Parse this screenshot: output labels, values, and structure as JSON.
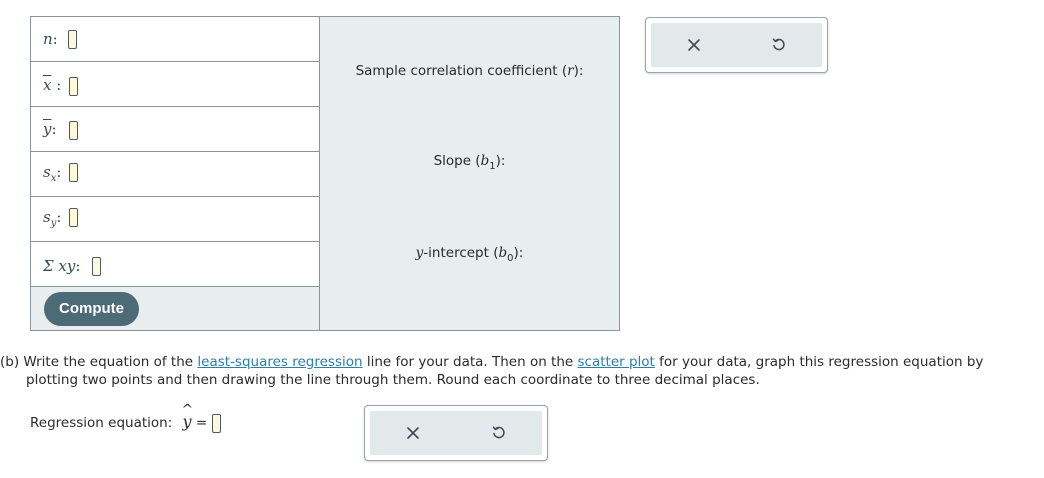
{
  "calculator": {
    "inputs": [
      {
        "id": "n",
        "label": "n",
        "value": ""
      },
      {
        "id": "xbar",
        "label": "x",
        "value": ""
      },
      {
        "id": "ybar",
        "label": "y",
        "value": ""
      },
      {
        "id": "sx",
        "label": "s",
        "sub": "x",
        "value": ""
      },
      {
        "id": "sy",
        "label": "s",
        "sub": "y",
        "value": ""
      },
      {
        "id": "sumxy",
        "label": "Σ xy",
        "value": ""
      }
    ],
    "compute_label": "Compute",
    "outputs": {
      "r_label_prefix": "Sample correlation coefficient (",
      "r_label_var": "r",
      "r_label_suffix": "):",
      "slope_prefix": "Slope (",
      "slope_var": "b",
      "slope_sub": "1",
      "slope_suffix": "):",
      "intercept_var": "y",
      "intercept_mid": "-intercept (",
      "intercept_var2": "b",
      "intercept_sub": "0",
      "intercept_suffix": "):"
    }
  },
  "actions": {
    "clear_icon": "close-icon",
    "undo_icon": "undo-icon"
  },
  "part_b": {
    "prefix": "(b) Write the equation of the ",
    "link1": "least-squares regression",
    "mid1": " line for your data. Then on the ",
    "link2": "scatter plot",
    "mid2": " for your data, graph this regression equation by",
    "line2": "plotting two points and then drawing the line through them. Round each coordinate to three decimal places."
  },
  "regression": {
    "label": "Regression equation: ",
    "var": "y",
    "equals": " = ",
    "value": ""
  },
  "colors": {
    "panel_bg": "#e8edee",
    "button": "#4d6b76",
    "link": "#2b7fa6",
    "answer_box": "#fff9da"
  }
}
